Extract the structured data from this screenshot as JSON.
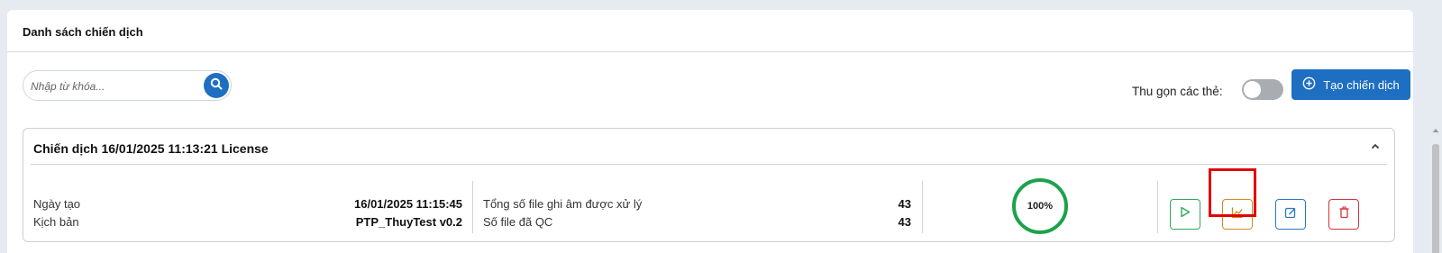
{
  "panel": {
    "title": "Danh sách chiến dịch"
  },
  "search": {
    "placeholder": "Nhập từ khóa...",
    "icon": "search-icon"
  },
  "toolbar": {
    "collapse_label": "Thu gọn các thẻ:",
    "collapse_enabled": false,
    "create_label": "Tạo chiến dịch",
    "create_icon": "plus-circle-icon"
  },
  "campaign": {
    "title": "Chiến dịch 16/01/2025 11:13:21 License",
    "created_label": "Ngày tạo",
    "created_value": "16/01/2025 11:15:45",
    "script_label": "Kịch bản",
    "script_value": "PTP_ThuyTest v0.2",
    "total_files_label": "Tổng số file ghi âm được xử lý",
    "total_files_value": "43",
    "qc_files_label": "Số file đã QC",
    "qc_files_value": "43",
    "progress_text": "100%",
    "progress": 1.0
  },
  "actions": {
    "play_icon": "play-icon",
    "stats_icon": "chart-icon",
    "edit_icon": "edit-icon",
    "delete_icon": "trash-icon"
  },
  "colors": {
    "primary": "#1e6fc2",
    "success": "#1aa34a",
    "warning": "#d18a1f",
    "danger": "#d2343b",
    "highlight": "#e00000"
  }
}
